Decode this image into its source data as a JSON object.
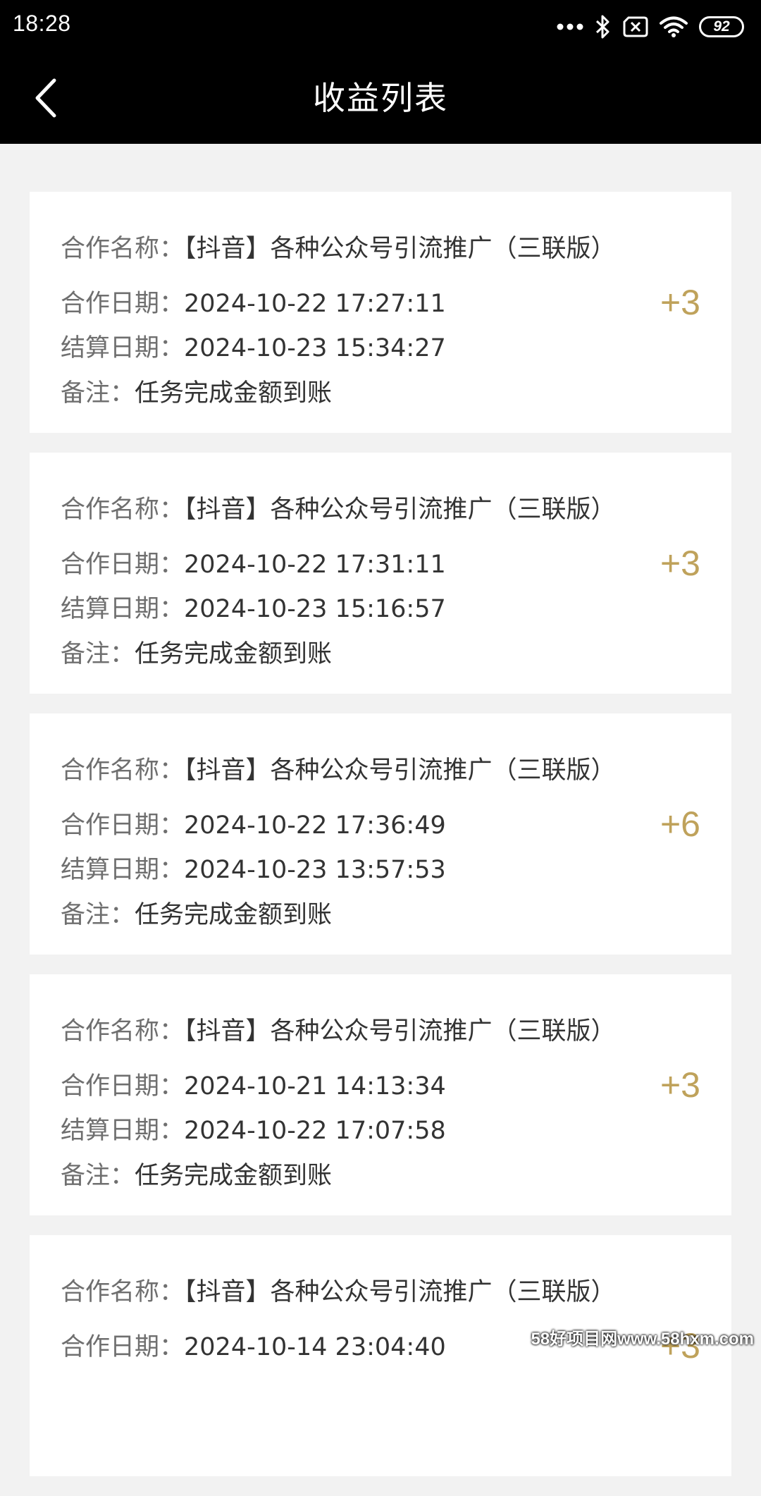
{
  "status_bar": {
    "time": "18:28",
    "battery": "92",
    "icons": [
      "more-dots-icon",
      "bluetooth-icon",
      "sim-no-signal-icon",
      "wifi-icon",
      "battery-icon"
    ]
  },
  "header": {
    "title": "收益列表",
    "back_icon": "chevron-left-icon"
  },
  "labels": {
    "name": "合作名称：",
    "coop_date": "合作日期：",
    "settle_date": "结算日期：",
    "note": "备注："
  },
  "records": [
    {
      "name": "【抖音】各种公众号引流推广（三联版）",
      "coop_date": "2024-10-22 17:27:11",
      "settle_date": "2024-10-23 15:34:27",
      "note": "任务完成金额到账",
      "amount": "+3"
    },
    {
      "name": "【抖音】各种公众号引流推广（三联版）",
      "coop_date": "2024-10-22 17:31:11",
      "settle_date": "2024-10-23 15:16:57",
      "note": "任务完成金额到账",
      "amount": "+3"
    },
    {
      "name": "【抖音】各种公众号引流推广（三联版）",
      "coop_date": "2024-10-22 17:36:49",
      "settle_date": "2024-10-23 13:57:53",
      "note": "任务完成金额到账",
      "amount": "+6"
    },
    {
      "name": "【抖音】各种公众号引流推广（三联版）",
      "coop_date": "2024-10-21 14:13:34",
      "settle_date": "2024-10-22 17:07:58",
      "note": "任务完成金额到账",
      "amount": "+3"
    },
    {
      "name": "【抖音】各种公众号引流推广（三联版）",
      "coop_date": "2024-10-14 23:04:40",
      "settle_date": "",
      "note": "",
      "amount": "+3"
    }
  ],
  "watermark": "58好项目网www.58hxm.com",
  "colors": {
    "header_bg": "#000000",
    "page_bg": "#f2f2f2",
    "card_bg": "#ffffff",
    "amount": "#bfa25b",
    "text": "#444444"
  }
}
